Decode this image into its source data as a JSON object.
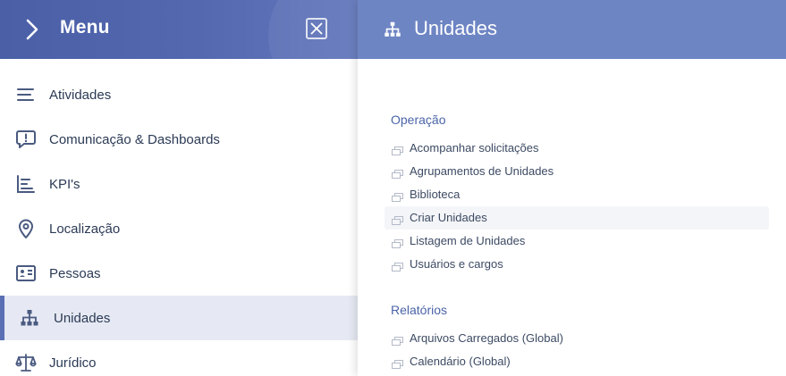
{
  "menu": {
    "title": "Menu",
    "items": [
      {
        "label": "Atividades",
        "icon": "list-icon"
      },
      {
        "label": "Comunicação & Dashboards",
        "icon": "message-alert-icon"
      },
      {
        "label": "KPI's",
        "icon": "bar-chart-icon"
      },
      {
        "label": "Localização",
        "icon": "location-pin-icon"
      },
      {
        "label": "Pessoas",
        "icon": "id-card-icon"
      },
      {
        "label": "Unidades",
        "icon": "org-chart-icon",
        "active": true
      },
      {
        "label": "Jurídico",
        "icon": "scales-icon"
      }
    ]
  },
  "panel": {
    "title": "Unidades",
    "sections": [
      {
        "title": "Operação",
        "links": [
          "Acompanhar solicitações",
          "Agrupamentos de Unidades",
          "Biblioteca",
          "Criar Unidades",
          "Listagem de Unidades",
          "Usuários e cargos"
        ]
      },
      {
        "title": "Relatórios",
        "links": [
          "Arquivos Carregados (Global)",
          "Calendário (Global)"
        ]
      }
    ]
  },
  "colors": {
    "menu_header": "#4a5fa6",
    "panel_header": "#6e85c4",
    "accent": "#5b6fb4",
    "active_bg": "#e6e9f3",
    "section_title": "#4b64a8"
  }
}
